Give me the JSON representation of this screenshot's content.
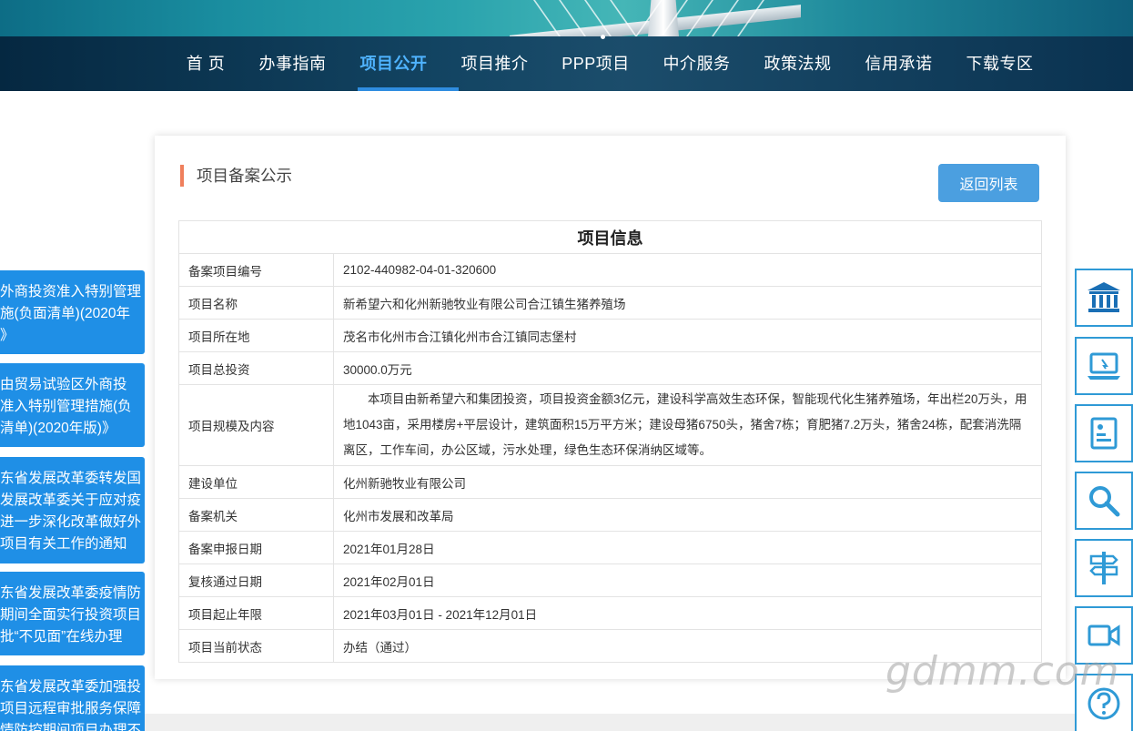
{
  "nav": {
    "items": [
      "首 页",
      "办事指南",
      "项目公开",
      "项目推介",
      "PPP项目",
      "中介服务",
      "政策法规",
      "信用承诺",
      "下载专区"
    ],
    "active_index": 2
  },
  "side_links": [
    [
      "外商投资准入特别管理",
      "施(负面清单)(2020年",
      "》"
    ],
    [
      "由贸易试验区外商投",
      "准入特别管理措施(负",
      "清单)(2020年版)》"
    ],
    [
      "东省发展改革委转发国",
      "发展改革委关于应对疫",
      "进一步深化改革做好外",
      "项目有关工作的通知"
    ],
    [
      "东省发展改革委疫情防",
      "期间全面实行投资项目",
      "批“不见面”在线办理"
    ],
    [
      "东省发展改革委加强投",
      "项目远程审批服务保障",
      "情防控期间项目办理不"
    ]
  ],
  "card": {
    "title": "项目备案公示",
    "back_button": "返回列表",
    "table_header": "项目信息",
    "rows": [
      {
        "label": "备案项目编号",
        "value": "2102-440982-04-01-320600"
      },
      {
        "label": "项目名称",
        "value": "新希望六和化州新驰牧业有限公司合江镇生猪养殖场"
      },
      {
        "label": "项目所在地",
        "value": "茂名市化州市合江镇化州市合江镇同志堡村"
      },
      {
        "label": "项目总投资",
        "value": "30000.0万元"
      },
      {
        "label": "项目规模及内容",
        "value": "本项目由新希望六和集团投资，项目投资金额3亿元，建设科学高效生态环保，智能现代化生猪养殖场，年出栏20万头，用地1043亩，采用楼房+平层设计，建筑面积15万平方米；建设母猪6750头，猪舍7栋；育肥猪7.2万头，猪舍24栋，配套消洗隔离区，工作车间，办公区域，污水处理，绿色生态环保消纳区域等。"
      },
      {
        "label": "建设单位",
        "value": "化州新驰牧业有限公司"
      },
      {
        "label": "备案机关",
        "value": "化州市发展和改革局"
      },
      {
        "label": "备案申报日期",
        "value": "2021年01月28日"
      },
      {
        "label": "复核通过日期",
        "value": "2021年02月01日"
      },
      {
        "label": "项目起止年限",
        "value": "2021年03月01日 - 2021年12月01日"
      },
      {
        "label": "项目当前状态",
        "value": "办结（通过）"
      }
    ]
  },
  "tools": [
    "bank-icon",
    "laptop-icon",
    "document-icon",
    "search-icon",
    "signpost-icon",
    "video-icon",
    "help-icon"
  ],
  "watermark": "gdmm.com",
  "colors": {
    "accent": "#1f8fe6",
    "nav_bg": "#0a3a5a",
    "active_nav": "#4fb3ff",
    "title_bar": "#ef7f5c",
    "button": "#4b9fe0"
  }
}
